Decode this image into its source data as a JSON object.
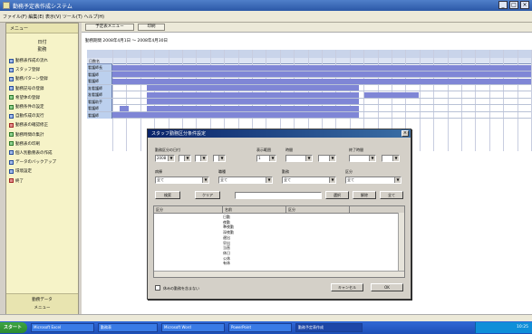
{
  "window": {
    "title": "勤務予定表作成システム"
  },
  "menubar": {
    "text": "ファイル(F)  編集(E)  表示(V)  ツール(T)  ヘルプ(H)"
  },
  "sidebar": {
    "top": "メニュー",
    "title1": "日付",
    "title2": "勤務",
    "items": [
      "勤務表作成の流れ",
      "スタッフ登録",
      "勤務パターン登録",
      "勤務記号の登録",
      "希望休の登録",
      "勤務条件の設定",
      "自動作成の実行",
      "勤務表の確認修正",
      "勤務時間の集計",
      "勤務表の印刷",
      "個人別勤務表の作成",
      "データのバックアップ",
      "環境設定",
      "終了"
    ],
    "bottom1": "勤務データ",
    "bottom2": "メニュー"
  },
  "toolbar": {
    "btn1": "予定表メニュー",
    "btn2": "印刷"
  },
  "period": "勤務期間 2008年4月1日 ～ 2008年4月30日",
  "grid": {
    "header_label": "日数名",
    "rows": [
      "看護師長",
      "看護師",
      "看護師",
      "准看護師",
      "准看護師",
      "看護助手",
      "看護師",
      "看護師"
    ]
  },
  "dialog": {
    "title": "スタッフ勤務区分条件設定",
    "f1": "勤務区分の日付",
    "f1v": "2008",
    "f2": "表示範囲",
    "f2v": "1",
    "f3": "時間",
    "f4": "終了時間",
    "c1": "病棟",
    "c1v": "全て",
    "c2": "職種",
    "c2v": "全て",
    "c3": "勤務",
    "c3v": "全て",
    "c4": "区分",
    "c4v": "全て",
    "btn_search": "検索",
    "btn_clear": "クリア",
    "btn_a": "選択",
    "btn_b": "解除",
    "btn_c": "全て",
    "list_h1": "区分",
    "list_h2": "名前",
    "list_h3": "区分",
    "list_items": [
      "日勤",
      "夜勤",
      "準夜勤",
      "深夜勤",
      "遅出",
      "早出",
      "当直",
      "休日",
      "公休",
      "有休"
    ],
    "chk_label": "休みの勤務を含まない",
    "btn_ok": "OK",
    "btn_cancel": "キャンセル"
  },
  "taskbar": {
    "start": "スタート",
    "tasks": [
      "Microsoft Excel",
      "勤務表",
      "Microsoft Word",
      "PowerPoint",
      "勤務予定表作成"
    ],
    "time": "10:25"
  }
}
